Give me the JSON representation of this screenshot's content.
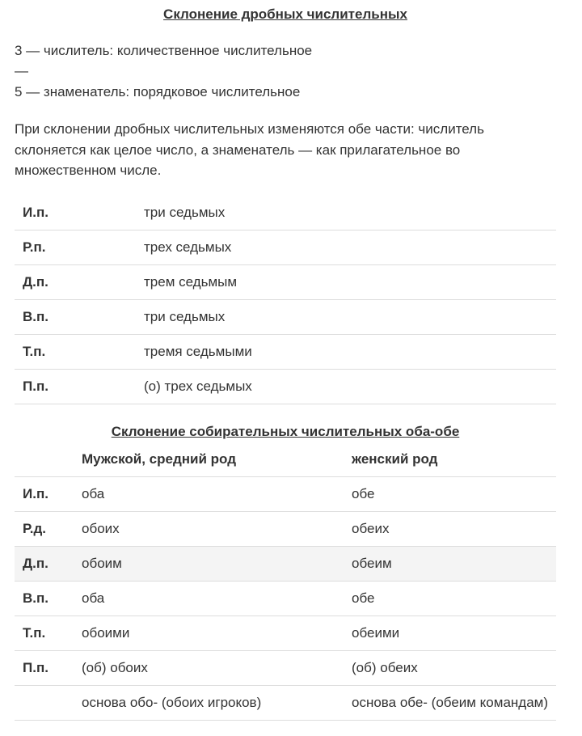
{
  "fractional": {
    "title": "Склонение дробных числительных",
    "lines": [
      "3 — числитель: количественное числительное",
      "—",
      "5 — знаменатель: порядковое числительное"
    ],
    "paragraph": "При склонении дробных числительных изменяются обе части: числитель склоняется как целое число, а знаменатель — как прилагательное во множественном числе.",
    "rows": [
      {
        "case": "И.п.",
        "form": "три седьмых"
      },
      {
        "case": "Р.п.",
        "form": "трех седьмых"
      },
      {
        "case": "Д.п.",
        "form": "трем седьмым"
      },
      {
        "case": "В.п.",
        "form": "три седьмых"
      },
      {
        "case": "Т.п.",
        "form": "тремя седьмыми"
      },
      {
        "case": "П.п.",
        "form": "(о) трех седьмых"
      }
    ]
  },
  "collective": {
    "title": "Склонение собирательных числительных оба-обе",
    "headers": {
      "case": "",
      "masc": "Мужской, средний  род",
      "fem": "женский род"
    },
    "rows": [
      {
        "case": "И.п.",
        "masc": "оба",
        "fem": "обе"
      },
      {
        "case": "Р.д.",
        "masc": "обоих",
        "fem": "обеих"
      },
      {
        "case": "Д.п.",
        "masc": "обоим",
        "fem": "обеим"
      },
      {
        "case": "В.п.",
        "masc": "оба",
        "fem": "обе"
      },
      {
        "case": "Т.п.",
        "masc": "обоими",
        "fem": "обеими"
      },
      {
        "case": "П.п.",
        "masc": "(об) обоих",
        "fem": "(об) обеих"
      },
      {
        "case": "",
        "masc": "основа обо- (обоих игроков)",
        "fem": "основа обе- (обеим командам)"
      }
    ]
  }
}
